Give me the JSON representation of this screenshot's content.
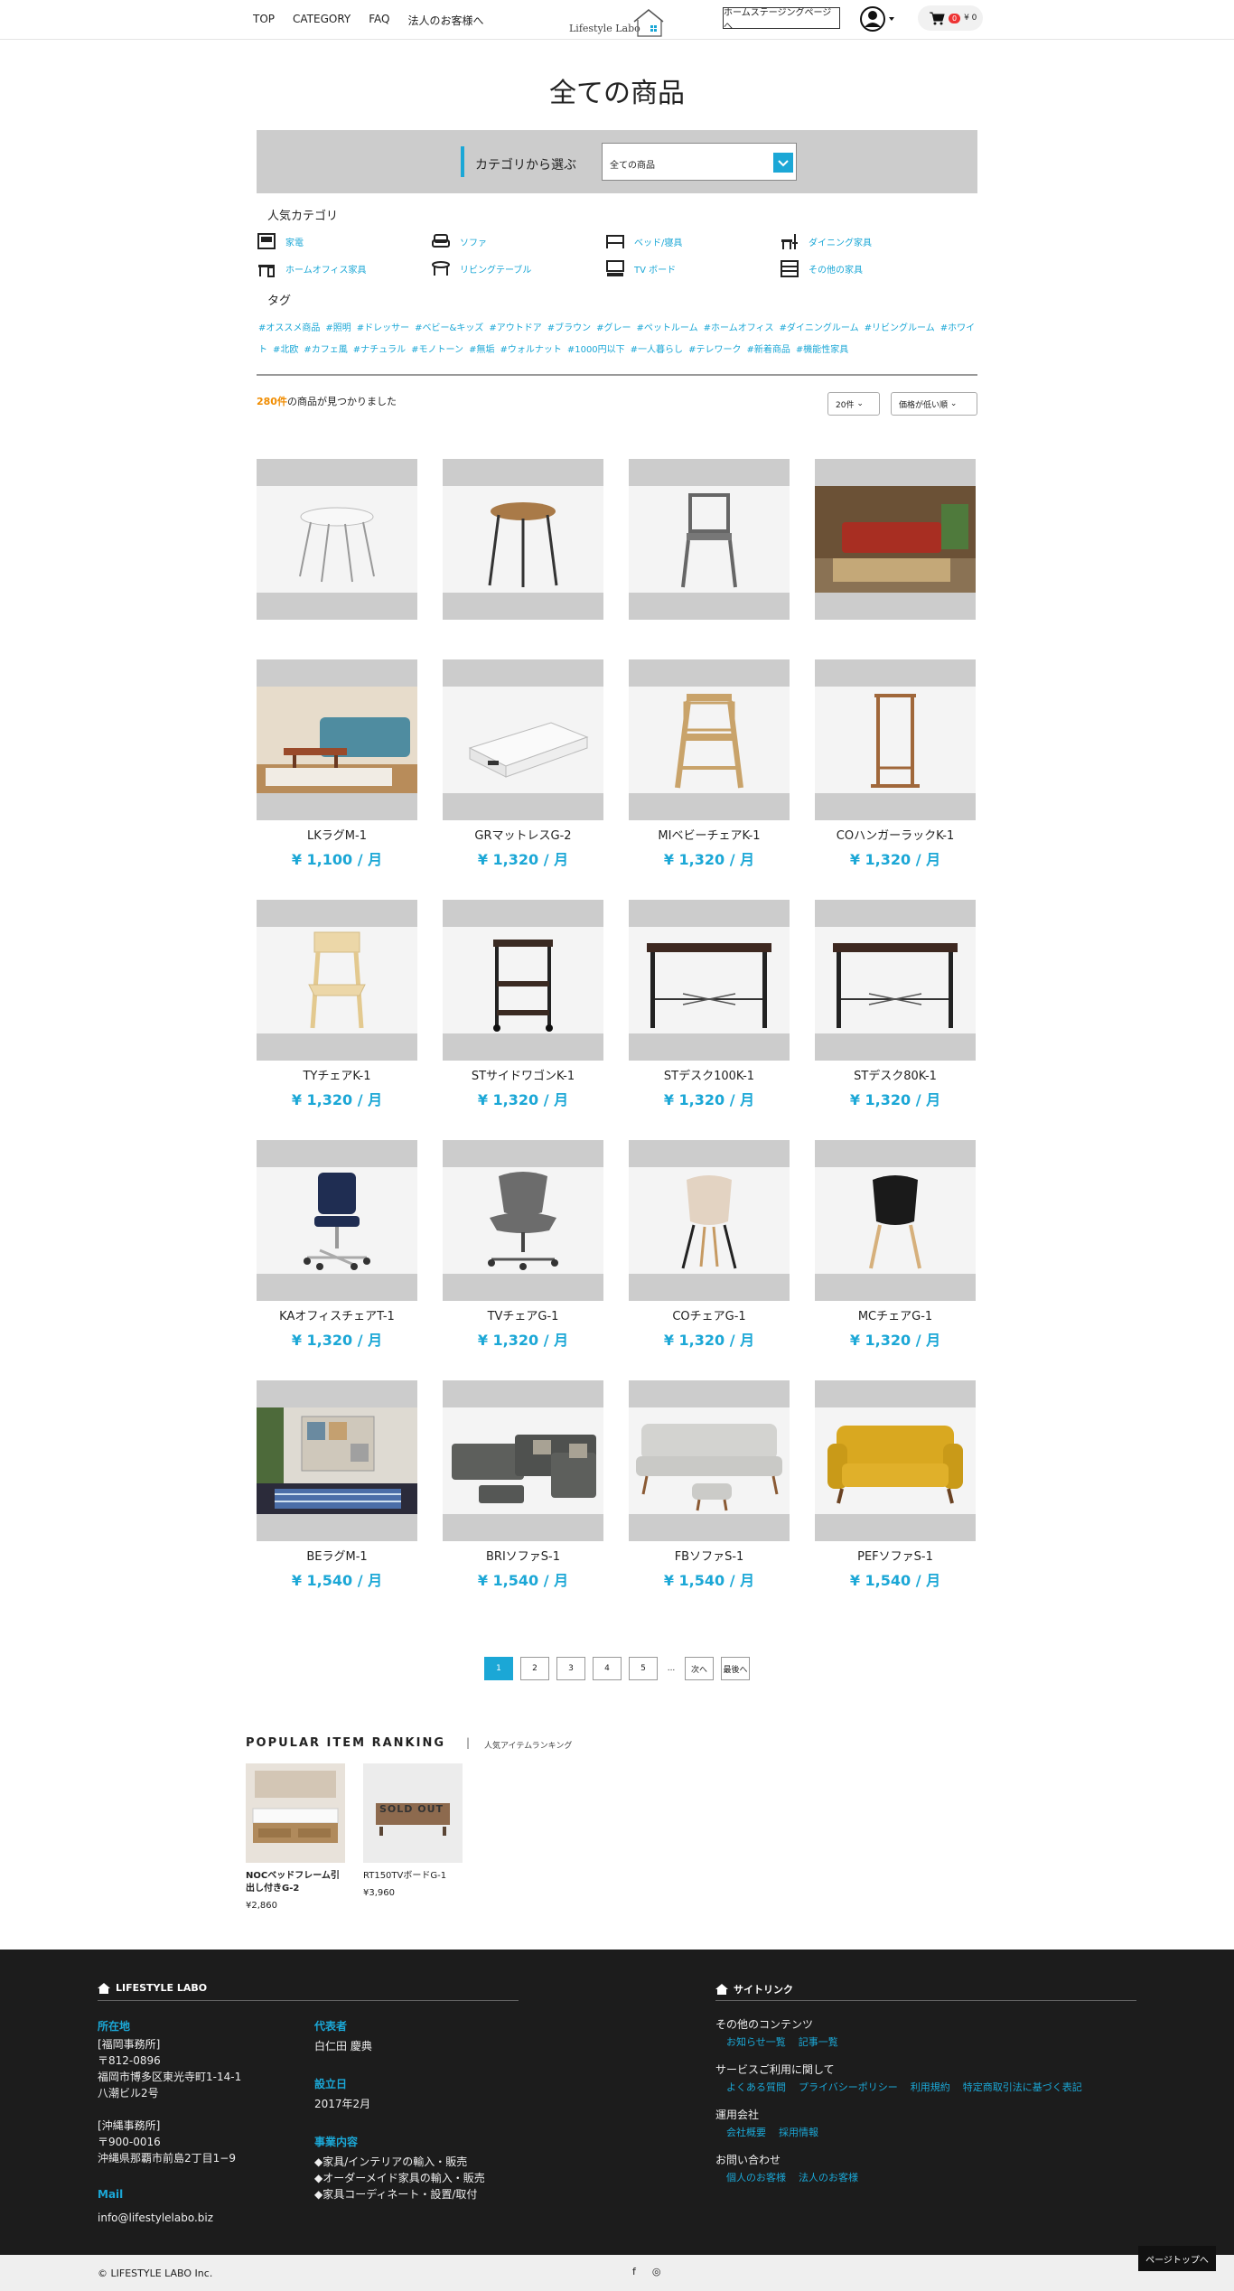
{
  "header": {
    "nav": [
      "TOP",
      "CATEGORY",
      "FAQ",
      "法人のお客様へ"
    ],
    "logo_text": "Lifestyle Labo",
    "staging_button": "ホームステージングページへ",
    "cart_count": "0",
    "cart_total": "¥ 0"
  },
  "page_title": "全ての商品",
  "filter": {
    "label": "カテゴリから選ぶ",
    "selected": "全ての商品"
  },
  "popular_categories": {
    "heading": "人気カテゴリ",
    "items": [
      {
        "label": "家電",
        "icon": "appliance-icon"
      },
      {
        "label": "ソファ",
        "icon": "sofa-icon"
      },
      {
        "label": "ベッド/寝具",
        "icon": "bed-icon"
      },
      {
        "label": "ダイニング家具",
        "icon": "dining-icon"
      },
      {
        "label": "ホームオフィス家具",
        "icon": "desk-icon"
      },
      {
        "label": "リビングテーブル",
        "icon": "table-icon"
      },
      {
        "label": "TV ボード",
        "icon": "tv-icon"
      },
      {
        "label": "その他の家具",
        "icon": "cabinet-icon"
      }
    ]
  },
  "tags": {
    "heading": "タグ",
    "items": [
      "#オススメ商品",
      "#照明",
      "#ドレッサー",
      "#ベビー&キッズ",
      "#アウトドア",
      "#ブラウン",
      "#グレー",
      "#ペットルーム",
      "#ホームオフィス",
      "#ダイニングルーム",
      "#リビングルーム",
      "#ホワイト",
      "#北欧",
      "#カフェ風",
      "#ナチュラル",
      "#モノトーン",
      "#無垢",
      "#ウォルナット",
      "#1000円以下",
      "#一人暮らし",
      "#テレワーク",
      "#新着商品",
      "#機能性家具"
    ]
  },
  "results": {
    "count": "280件",
    "suffix": "の商品が見つかりました",
    "per_page": "20件",
    "sort": "価格が低い順"
  },
  "products": [
    {
      "name": "",
      "price": "",
      "shape": "stool-white"
    },
    {
      "name": "",
      "price": "",
      "shape": "stool-wood"
    },
    {
      "name": "",
      "price": "",
      "shape": "chair-metal"
    },
    {
      "name": "",
      "price": "",
      "shape": "room-red-sofa"
    },
    {
      "name": "LKラグM-1",
      "price": "¥ 1,100 / 月",
      "shape": "room-blue-sofa"
    },
    {
      "name": "GRマットレスG-2",
      "price": "¥ 1,320 / 月",
      "shape": "mattress"
    },
    {
      "name": "MIベビーチェアK-1",
      "price": "¥ 1,320 / 月",
      "shape": "baby-chair"
    },
    {
      "name": "COハンガーラックK-1",
      "price": "¥ 1,320 / 月",
      "shape": "hanger"
    },
    {
      "name": "TYチェアK-1",
      "price": "¥ 1,320 / 月",
      "shape": "folding-chair"
    },
    {
      "name": "STサイドワゴンK-1",
      "price": "¥ 1,320 / 月",
      "shape": "side-wagon"
    },
    {
      "name": "STデスク100K-1",
      "price": "¥ 1,320 / 月",
      "shape": "desk"
    },
    {
      "name": "STデスク80K-1",
      "price": "¥ 1,320 / 月",
      "shape": "desk"
    },
    {
      "name": "KAオフィスチェアT-1",
      "price": "¥ 1,320 / 月",
      "shape": "office-chair-blue"
    },
    {
      "name": "TVチェアG-1",
      "price": "¥ 1,320 / 月",
      "shape": "office-chair-gray"
    },
    {
      "name": "COチェアG-1",
      "price": "¥ 1,320 / 月",
      "shape": "shell-chair-beige"
    },
    {
      "name": "MCチェアG-1",
      "price": "¥ 1,320 / 月",
      "shape": "shell-chair-black"
    },
    {
      "name": "BEラグM-1",
      "price": "¥ 1,540 / 月",
      "shape": "room-rug"
    },
    {
      "name": "BRIソファS-1",
      "price": "¥ 1,540 / 月",
      "shape": "corner-sofa"
    },
    {
      "name": "FBソファS-1",
      "price": "¥ 1,540 / 月",
      "shape": "gray-sofa"
    },
    {
      "name": "PEFソファS-1",
      "price": "¥ 1,540 / 月",
      "shape": "yellow-sofa"
    }
  ],
  "pagination": {
    "pages": [
      "1",
      "2",
      "3",
      "4",
      "5"
    ],
    "dots": "...",
    "next": "次へ",
    "last": "最後へ"
  },
  "ranking": {
    "heading": "POPULAR ITEM RANKING",
    "separator": "|",
    "subheading": "人気アイテムランキング",
    "items": [
      {
        "name": "NOCベッドフレーム引出し付きG-2",
        "price": "¥2,860"
      },
      {
        "name": "RT150TVボードG-1",
        "price": "¥3,960",
        "status": "SOLD OUT"
      }
    ]
  },
  "footer": {
    "brand": "LIFESTYLE LABO",
    "site_links_heading": "サイトリンク",
    "address_label": "所在地",
    "address_fukuoka": "[福岡事務所]\n〒812-0896\n福岡市博多区東光寺町1-14-1\n八潮ビル2号",
    "address_okinawa": "[沖縄事務所]\n〒900-0016\n沖縄県那覇市前島2丁目1−9",
    "mail_label": "Mail",
    "mail": "info@lifestylelabo.biz",
    "rep_label": "代表者",
    "rep": "白仁田 慶典",
    "est_label": "設立日",
    "est": "2017年2月",
    "business_label": "事業内容",
    "business": "◆家具/インテリアの輸入・販売\n◆オーダーメイド家具の輸入・販売\n◆家具コーディネート・設置/取付",
    "groups": [
      {
        "title": "その他のコンテンツ",
        "links": [
          "お知らせ一覧",
          "記事一覧"
        ]
      },
      {
        "title": "サービスご利用に関して",
        "links": [
          "よくある質問",
          "プライバシーポリシー",
          "利用規約",
          "特定商取引法に基づく表記"
        ]
      },
      {
        "title": "運用会社",
        "links": [
          "会社概要",
          "採用情報"
        ]
      },
      {
        "title": "お問い合わせ",
        "links": [
          "個人のお客様",
          "法人のお客様"
        ]
      }
    ],
    "copyright": "© LIFESTYLE LABO Inc.",
    "social": [
      "f",
      "◎"
    ],
    "to_top": "ページトップへ"
  },
  "colors": {
    "accent": "#1ba7d6",
    "count": "#f08c00",
    "footer_bg": "#1c1c1c"
  }
}
